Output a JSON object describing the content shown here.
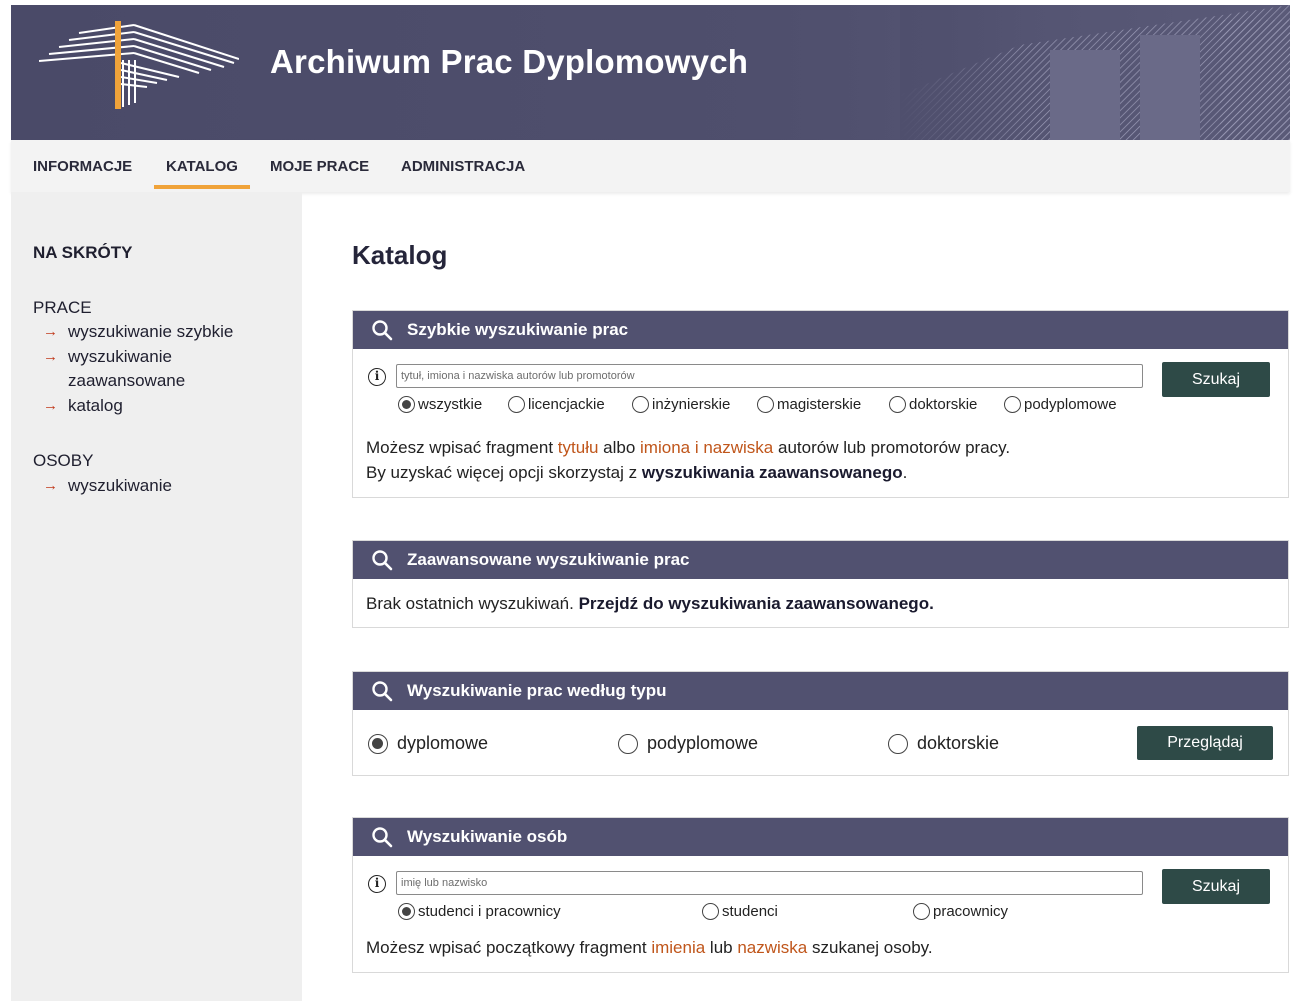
{
  "header": {
    "site_title": "Archiwum Prac Dyplomowych"
  },
  "nav": {
    "items": [
      {
        "label": "INFORMACJE",
        "active": false
      },
      {
        "label": "KATALOG",
        "active": true
      },
      {
        "label": "MOJE PRACE",
        "active": false
      },
      {
        "label": "ADMINISTRACJA",
        "active": false
      }
    ],
    "accent_color": "#f0a33a"
  },
  "sidebar": {
    "title": "NA SKRÓTY",
    "groups": [
      {
        "label": "PRACE",
        "links": [
          "wyszukiwanie szybkie",
          "wyszukiwanie zaawansowane",
          "katalog"
        ]
      },
      {
        "label": "OSOBY",
        "links": [
          "wyszukiwanie"
        ]
      }
    ],
    "arrow": "→"
  },
  "main": {
    "title": "Katalog",
    "quick": {
      "title": "Szybkie wyszukiwanie prac",
      "placeholder": "tytuł, imiona i nazwiska autorów lub promotorów",
      "button": "Szukaj",
      "options": [
        "wszystkie",
        "licencjackie",
        "inżynierskie",
        "magisterskie",
        "doktorskie",
        "podyplomowe"
      ],
      "selected": "wszystkie",
      "help1": {
        "a": "Możesz wpisać fragment ",
        "b": "tytułu",
        "c": " albo ",
        "d": "imiona i nazwiska",
        "e": " autorów lub promotorów pracy."
      },
      "help2": {
        "a": "By uzyskać więcej opcji skorzystaj z ",
        "b": "wyszukiwania zaawansowanego",
        "c": "."
      }
    },
    "advanced": {
      "title": "Zaawansowane wyszukiwanie prac",
      "text": "Brak ostatnich wyszukiwań. ",
      "link": "Przejdź do wyszukiwania zaawansowanego."
    },
    "by_type": {
      "title": "Wyszukiwanie prac według typu",
      "options": [
        "dyplomowe",
        "podyplomowe",
        "doktorskie"
      ],
      "selected": "dyplomowe",
      "button": "Przeglądaj"
    },
    "people": {
      "title": "Wyszukiwanie osób",
      "placeholder": "imię lub nazwisko",
      "button": "Szukaj",
      "options": [
        "studenci i pracownicy",
        "studenci",
        "pracownicy"
      ],
      "selected": "studenci i pracownicy",
      "help": {
        "a": "Możesz wpisać początkowy fragment ",
        "b": "imienia",
        "c": " lub ",
        "d": "nazwiska",
        "e": " szukanej osoby."
      }
    }
  },
  "colors": {
    "header_bg": "#4f4f6d",
    "panel_head": "#515170",
    "button": "#2e4a47",
    "highlight": "#c0561b",
    "sidebar_bg": "#efefef"
  }
}
